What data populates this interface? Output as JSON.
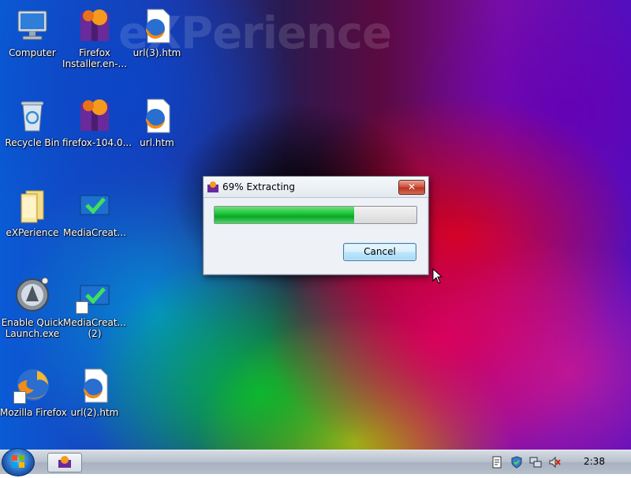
{
  "desktop": {
    "watermark": "eXPerience",
    "icons": [
      {
        "label": "Computer"
      },
      {
        "label": "Firefox Installer.en-..."
      },
      {
        "label": "url(3).htm"
      },
      {
        "label": "Recycle Bin"
      },
      {
        "label": "firefox-104.0..."
      },
      {
        "label": "url.htm"
      },
      {
        "label": "eXPerience"
      },
      {
        "label": "MediaCreat..."
      },
      {
        "label": "Enable Quick Launch.exe"
      },
      {
        "label": "MediaCreat... (2)"
      },
      {
        "label": "Mozilla Firefox"
      },
      {
        "label": "url(2).htm"
      }
    ]
  },
  "dialog": {
    "title": "69% Extracting",
    "close_label": "✕",
    "progress_percent": 69,
    "cancel_label": "Cancel"
  },
  "taskbar": {
    "clock": "2:38"
  },
  "icons_semantic": [
    "computer-icon",
    "firefox-installer-icon",
    "htm-file-icon",
    "recycle-bin-icon",
    "folder-icon",
    "media-creation-icon",
    "quick-launch-icon",
    "firefox-icon"
  ]
}
